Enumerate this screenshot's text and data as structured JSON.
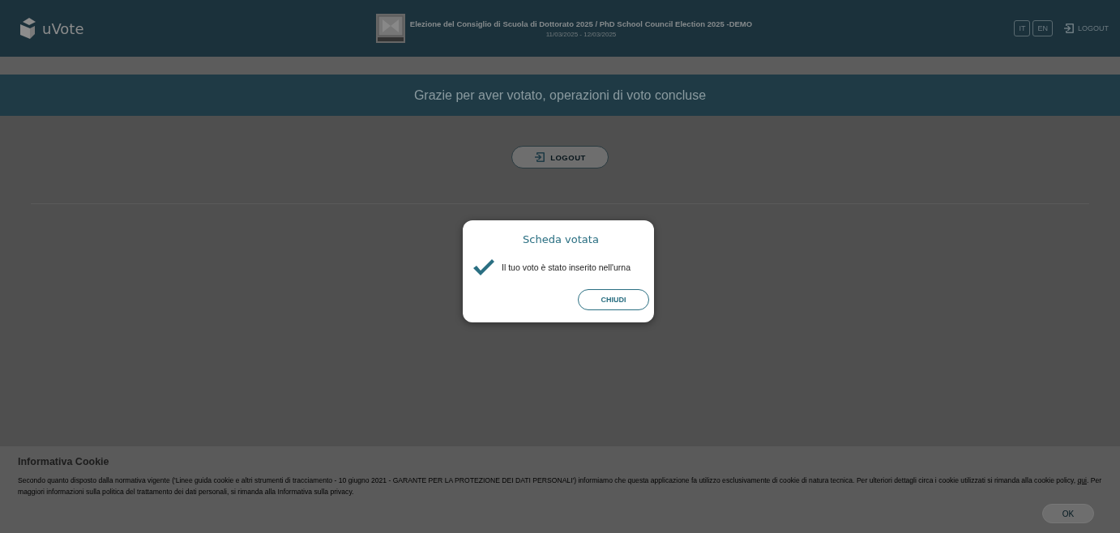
{
  "header": {
    "logo": "uVote",
    "title": "Elezione del Consiglio di Scuola di Dottorato 2025 / PhD School Council Election 2025 -DEMO",
    "dates": "11/03/2025 - 12/03/2025",
    "languages": [
      {
        "label": "IT",
        "selected": false
      },
      {
        "label": "EN",
        "selected": false
      }
    ],
    "logout": "LOGOUT"
  },
  "banner": "Grazie per aver votato, operazioni di voto concluse",
  "logout_button": "LOGOUT",
  "dialog": {
    "title": "Scheda votata",
    "message": "Il tuo voto è stato inserito nell'urna",
    "button": "CHIUDI"
  },
  "cookie": {
    "title": "Informativa Cookie",
    "text_before": "Secondo quanto disposto dalla normativa vigente ('Linee guida cookie e altri strumenti di tracciamento - 10 giugno 2021 - GARANTE PER LA PROTEZIONE DEI DATI PERSONALI') informiamo che questa applicazione fa utilizzo esclusivamente di cookie di natura tecnica. Per ulteriori dettagli circa i cookie utilizzati si rimanda alla cookie policy, ",
    "link": "qui",
    "text_after": ". Per maggiori informazioni sulla politica del trattamento dei dati personali, si rimanda alla Informativa sulla privacy.",
    "button": "OK"
  }
}
